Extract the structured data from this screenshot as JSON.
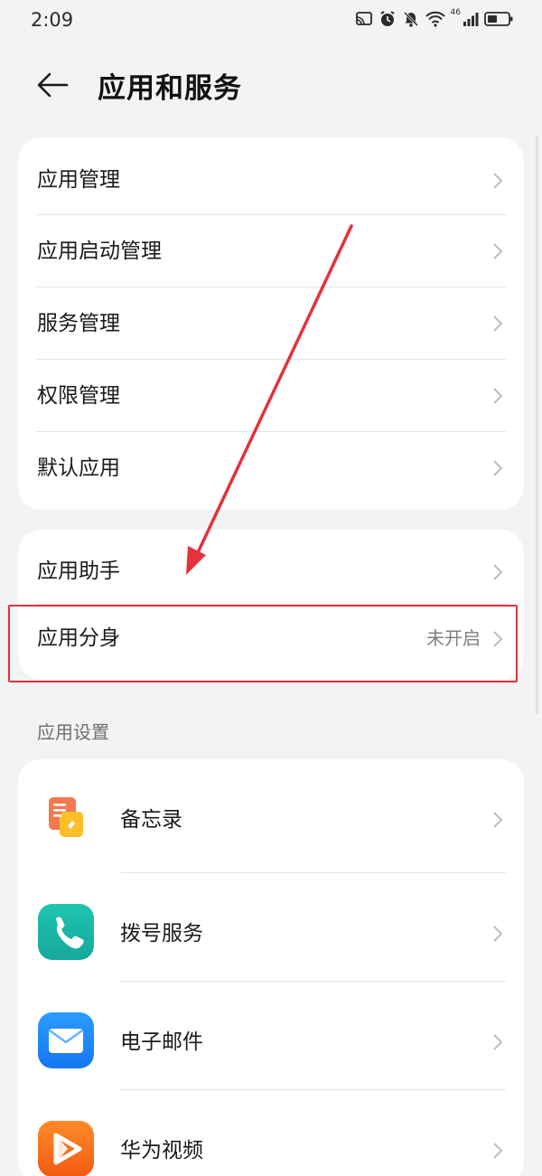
{
  "status_bar": {
    "time": "2:09",
    "network_label": "46"
  },
  "header": {
    "title": "应用和服务"
  },
  "group1": {
    "items": [
      {
        "label": "应用管理"
      },
      {
        "label": "应用启动管理"
      },
      {
        "label": "服务管理"
      },
      {
        "label": "权限管理"
      },
      {
        "label": "默认应用"
      }
    ]
  },
  "group2": {
    "items": [
      {
        "label": "应用助手",
        "value": ""
      },
      {
        "label": "应用分身",
        "value": "未开启"
      }
    ]
  },
  "app_settings": {
    "section_title": "应用设置",
    "apps": [
      {
        "label": "备忘录",
        "icon": "memo-icon"
      },
      {
        "label": "拨号服务",
        "icon": "dialer-icon"
      },
      {
        "label": "电子邮件",
        "icon": "email-icon"
      },
      {
        "label": "华为视频",
        "icon": "video-icon"
      }
    ]
  },
  "colors": {
    "background": "#f1f3f5",
    "card": "#ffffff",
    "annotation_red": "#e5323b"
  }
}
